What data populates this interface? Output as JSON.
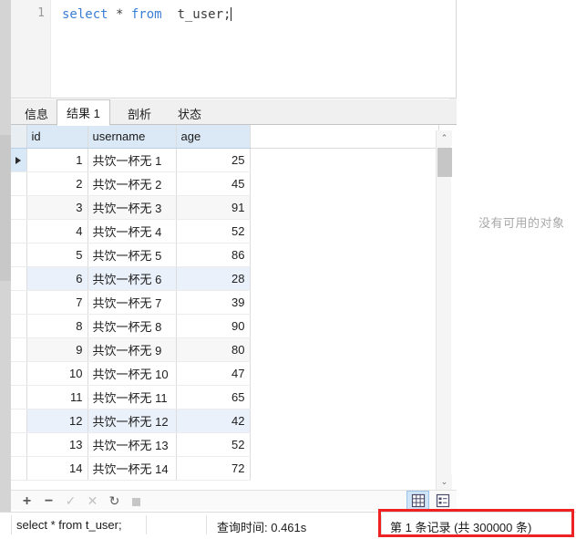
{
  "editor": {
    "line_number": "1",
    "sql_keyword_select": "select",
    "sql_star": " * ",
    "sql_keyword_from": "from",
    "sql_table": "  t_user;"
  },
  "tabs": [
    {
      "label": "信息",
      "active": false
    },
    {
      "label": "结果 1",
      "active": true
    },
    {
      "label": "剖析",
      "active": false
    },
    {
      "label": "状态",
      "active": false
    }
  ],
  "grid": {
    "columns": [
      "id",
      "username",
      "age"
    ],
    "rows": [
      {
        "id": "1",
        "username": "共饮一杯无 1",
        "age": "25"
      },
      {
        "id": "2",
        "username": "共饮一杯无 2",
        "age": "45"
      },
      {
        "id": "3",
        "username": "共饮一杯无 3",
        "age": "91"
      },
      {
        "id": "4",
        "username": "共饮一杯无 4",
        "age": "52"
      },
      {
        "id": "5",
        "username": "共饮一杯无 5",
        "age": "86"
      },
      {
        "id": "6",
        "username": "共饮一杯无 6",
        "age": "28"
      },
      {
        "id": "7",
        "username": "共饮一杯无 7",
        "age": "39"
      },
      {
        "id": "8",
        "username": "共饮一杯无 8",
        "age": "90"
      },
      {
        "id": "9",
        "username": "共饮一杯无 9",
        "age": "80"
      },
      {
        "id": "10",
        "username": "共饮一杯无 10",
        "age": "47"
      },
      {
        "id": "11",
        "username": "共饮一杯无 11",
        "age": "65"
      },
      {
        "id": "12",
        "username": "共饮一杯无 12",
        "age": "42"
      },
      {
        "id": "13",
        "username": "共饮一杯无 13",
        "age": "52"
      },
      {
        "id": "14",
        "username": "共饮一杯无 14",
        "age": "72"
      }
    ],
    "current_row_index": 0,
    "alt_row_indexes": [
      2,
      8
    ],
    "blue_row_indexes": [
      5,
      11
    ]
  },
  "toolbar": {
    "add": "+",
    "remove": "−",
    "confirm": "✓",
    "cancel": "✕",
    "refresh": "↻",
    "stop": "■",
    "view_grid": "grid-view",
    "view_form": "form-view"
  },
  "right_pane": {
    "empty_message": "没有可用的对象"
  },
  "statusbar": {
    "sql_text": "select * from  t_user;",
    "query_time": "查询时间: 0.461s",
    "record_info": "第 1 条记录  (共 300000 条)"
  },
  "scrollbar": {
    "up_arrow": "⌃",
    "down_arrow": "⌄"
  },
  "colors": {
    "header_bg": "#dbe9f7",
    "highlight_row": "#eaf1fa",
    "alt_row": "#f7f7f7",
    "accent_red": "#ee2222",
    "keyword_blue": "#3a7fd5"
  }
}
